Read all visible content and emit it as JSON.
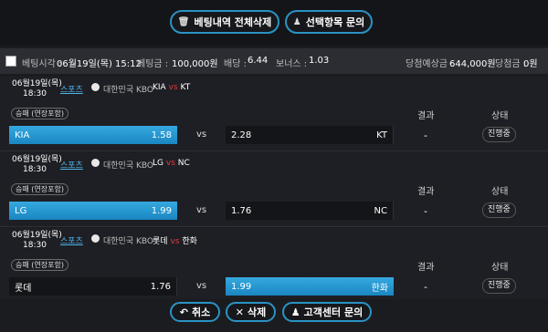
{
  "top_buttons": {
    "delete_all": "베팅내역 전체삭제",
    "inquiry_selected": "선택항목 문의"
  },
  "summary": {
    "bet_time_label": "베팅시각 :",
    "bet_time_value": "06월19일(목) 15:12",
    "bet_amount_label": "베팅금 :",
    "bet_amount_value": "100,000원",
    "odds_label": "배당 :",
    "odds_value": "6.44",
    "bonus_label": "보너스 :",
    "bonus_value": "1.03",
    "expected_win_label": "당첨예상금 :",
    "expected_win_value": "644,000원",
    "win_amount_label": "당첨금 :",
    "win_amount_value": "0원"
  },
  "col_headers": {
    "result": "결과",
    "status": "상태"
  },
  "bets": [
    {
      "date": "06월19일(목)",
      "time": "18:30",
      "sport": "스포츠",
      "league": "대한민국 KBO",
      "home": "KIA",
      "away": "KT",
      "vs_small": "vs",
      "market": "승패 (연장포함)",
      "home_odds": "1.58",
      "away_odds": "2.28",
      "vs": "vs",
      "result": "-",
      "status": "진행중",
      "selected": "home"
    },
    {
      "date": "06월19일(목)",
      "time": "18:30",
      "sport": "스포츠",
      "league": "대한민국 KBO",
      "home": "LG",
      "away": "NC",
      "vs_small": "vs",
      "market": "승패 (연장포함)",
      "home_odds": "1.99",
      "away_odds": "1.76",
      "vs": "vs",
      "result": "-",
      "status": "진행중",
      "selected": "home"
    },
    {
      "date": "06월19일(목)",
      "time": "18:30",
      "sport": "스포츠",
      "league": "대한민국 KBO",
      "home": "롯데",
      "away": "한화",
      "vs_small": "vs",
      "market": "승패 (연장포함)",
      "home_odds": "1.76",
      "away_odds": "1.99",
      "vs": "vs",
      "result": "-",
      "status": "진행중",
      "selected": "away"
    }
  ],
  "bottom_buttons": {
    "cancel": "취소",
    "delete": "삭제",
    "support": "고객센터 문의"
  },
  "colors": {
    "accent": "#2a93c4",
    "selected": "#1a86c2",
    "vs_red": "#e0393c"
  }
}
